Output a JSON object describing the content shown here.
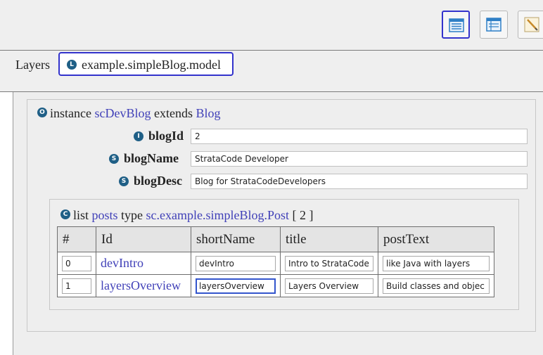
{
  "toolbar": {
    "buttons": [
      {
        "name": "form-view",
        "active": true
      },
      {
        "name": "table-view",
        "active": false
      },
      {
        "name": "code-view",
        "active": false
      }
    ]
  },
  "layers": {
    "label": "Layers",
    "selected_layer": "example.simpleBlog.model",
    "badge": "L"
  },
  "instance": {
    "badge": "O",
    "keyword": "instance",
    "name": "scDevBlog",
    "extends_keyword": "extends",
    "parent": "Blog"
  },
  "fields": [
    {
      "badge": "I",
      "label": "blogId",
      "value": "2"
    },
    {
      "badge": "S",
      "label": "blogName",
      "value": "StrataCode Developer"
    },
    {
      "badge": "S",
      "label": "blogDesc",
      "value": "Blog for StrataCodeDevelopers"
    }
  ],
  "list": {
    "badge": "C",
    "keyword": "list",
    "name": "posts",
    "type_keyword": "type",
    "type": "sc.example.simpleBlog.Post",
    "count": "[ 2 ]",
    "columns": [
      "#",
      "Id",
      "shortName",
      "title",
      "postText"
    ],
    "rows": [
      {
        "index": "0",
        "id": "devIntro",
        "shortName": "devIntro",
        "title": "Intro to StrataCode",
        "postText": "like Java with layers"
      },
      {
        "index": "1",
        "id": "layersOverview",
        "shortName": "layersOverview",
        "title": "Layers Overview",
        "postText": "Build classes and objec"
      }
    ]
  }
}
